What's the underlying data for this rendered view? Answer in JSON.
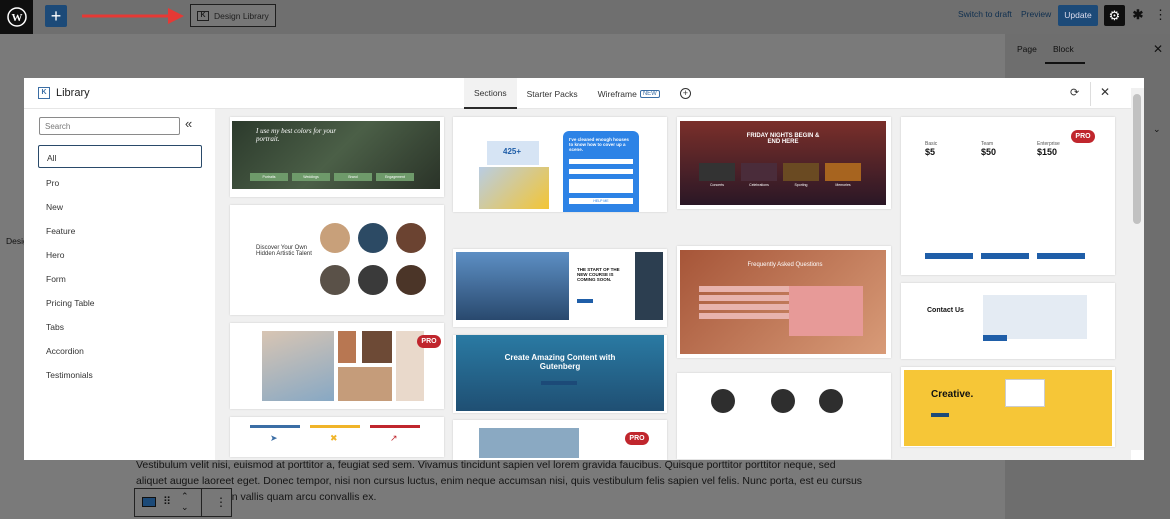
{
  "toolbar": {
    "design_library_label": "Design Library",
    "switch_draft": "Switch to draft",
    "preview": "Preview",
    "update": "Update"
  },
  "sidebar": {
    "tab_page": "Page",
    "tab_block": "Block"
  },
  "canvas": {
    "side_label": "Desig",
    "paragraph": "Vestibulum velit nisi, euismod at porttitor a, feugiat sed sem. Vivamus tincidunt sapien vel lorem gravida faucibus. Quisque porttitor porttitor neque, sed aliquet augue laoreet eget. Donec tempor, nisi non cursus luctus, enim neque accumsan nisi, quis vestibulum felis sapien vel felis. Nunc porta, est eu cursus facilisis, ipsum sapien vallis quam arcu convallis ex."
  },
  "modal": {
    "title": "Library",
    "tabs": [
      "Sections",
      "Starter Packs",
      "Wireframe"
    ],
    "new_badge": "NEW",
    "search_placeholder": "Search",
    "categories": [
      "All",
      "Pro",
      "New",
      "Feature",
      "Hero",
      "Form",
      "Pricing Table",
      "Tabs",
      "Accordion",
      "Testimonials"
    ],
    "pro_label": "PRO",
    "cards": {
      "portrait": "I use my best colors for your portrait.",
      "portrait_buttons": [
        "Portraits",
        "Weddings",
        "Brand",
        "Engagement"
      ],
      "stat": "425+",
      "form_heading": "I've cleaned enough houses to know how to cover up a scene.",
      "form_button": "HELP ME",
      "friday": "FRIDAY NIGHTS BEGIN & END HERE",
      "friday_labels": [
        "Concerts",
        "Celebrations",
        "Sporting",
        "Memories"
      ],
      "pricing": [
        {
          "name": "Basic",
          "price": "$5"
        },
        {
          "name": "Team",
          "price": "$50"
        },
        {
          "name": "Enterprise",
          "price": "$150"
        }
      ],
      "artistic": "Discover Your Own Hidden Artistic Talent",
      "course": "THE START OF THE NEW COURSE IS COMING SOON.",
      "faq": "Frequently Asked Questions",
      "contact": "Contact Us",
      "create": "Create Amazing Content with Gutenberg",
      "creative": "Creative."
    }
  },
  "colors": {
    "accent": "#1c4a78",
    "pro": "#c0262d",
    "creative_yellow": "#f6c637",
    "gutenberg_blue": "#1f4f73"
  }
}
